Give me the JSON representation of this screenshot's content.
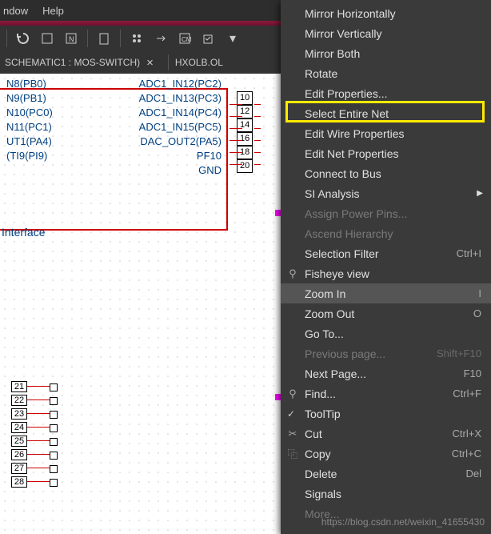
{
  "menubar": {
    "items": [
      "ndow",
      "Help"
    ]
  },
  "tabbar": {
    "tab1": "SCHEMATIC1 : MOS-SWITCH)",
    "tab2": "HXOLB.OL"
  },
  "pins": {
    "left": [
      "N8(PB0)",
      "N9(PB1)",
      "N10(PC0)",
      "N11(PC1)",
      "UT1(PA4)",
      "(TI9(PI9)"
    ],
    "right": [
      "ADC1_IN12(PC2)",
      "ADC1_IN13(PC3)",
      "ADC1_IN14(PC4)",
      "ADC1_IN15(PC5)",
      "DAC_OUT2(PA5)",
      "PF10",
      "GND"
    ],
    "nums_top": [
      "10",
      "12",
      "14",
      "16",
      "18",
      "20"
    ],
    "nums_bottom": [
      "21",
      "22",
      "23",
      "24",
      "25",
      "26",
      "27",
      "28"
    ],
    "interface_label": "Interface"
  },
  "menu": [
    {
      "label": "Mirror Horizontally"
    },
    {
      "label": "Mirror Vertically"
    },
    {
      "label": "Mirror Both"
    },
    {
      "label": "Rotate"
    },
    {
      "label": "Edit Properties..."
    },
    {
      "label": "Select Entire Net"
    },
    {
      "label": "Edit Wire Properties"
    },
    {
      "label": "Edit Net Properties"
    },
    {
      "label": "Connect to Bus"
    },
    {
      "label": "SI Analysis",
      "arrow": true
    },
    {
      "label": "Assign Power Pins...",
      "disabled": true
    },
    {
      "label": "Ascend Hierarchy",
      "disabled": true
    },
    {
      "label": "Selection Filter",
      "shortcut": "Ctrl+I"
    },
    {
      "label": "Fisheye view",
      "icon": "⚲"
    },
    {
      "label": "Zoom In",
      "shortcut": "I",
      "hover": true
    },
    {
      "label": "Zoom Out",
      "shortcut": "O"
    },
    {
      "label": "Go To..."
    },
    {
      "label": "Previous page...",
      "shortcut": "Shift+F10",
      "disabled": true
    },
    {
      "label": "Next Page...",
      "shortcut": "F10"
    },
    {
      "label": "Find...",
      "shortcut": "Ctrl+F",
      "icon": "⚲"
    },
    {
      "label": "ToolTip",
      "check": true
    },
    {
      "label": "Cut",
      "shortcut": "Ctrl+X",
      "icon": "✂"
    },
    {
      "label": "Copy",
      "shortcut": "Ctrl+C",
      "icon": "⿻"
    },
    {
      "label": "Delete",
      "shortcut": "Del"
    },
    {
      "label": "Signals"
    },
    {
      "label": "More...",
      "disabled": true
    }
  ],
  "watermark": "https://blog.csdn.net/weixin_41655430"
}
